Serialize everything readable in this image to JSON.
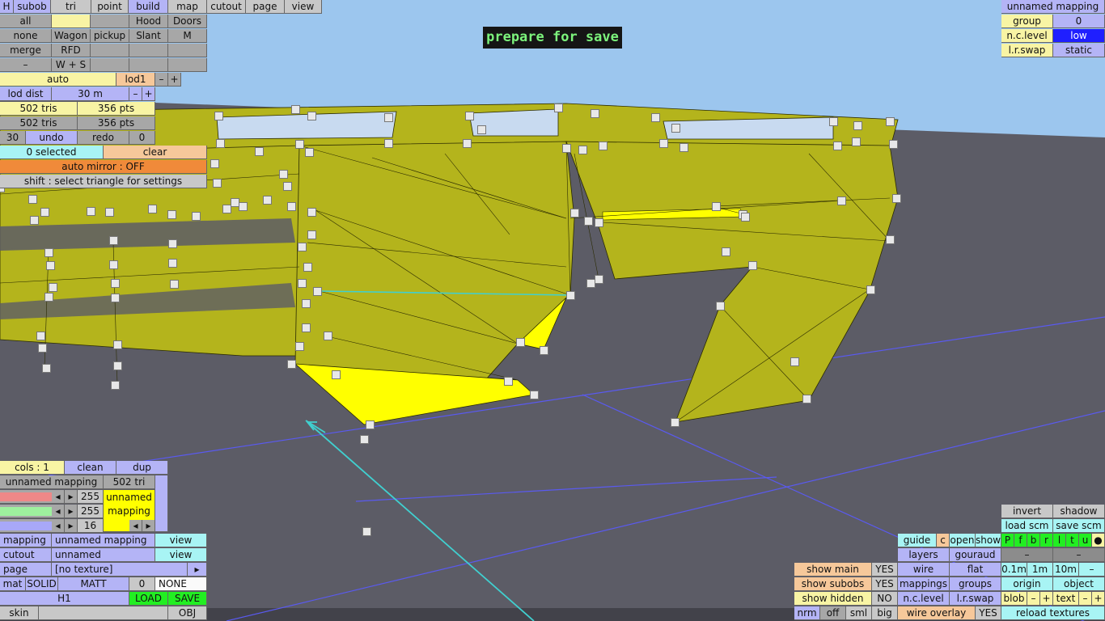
{
  "banner": "prepare for save",
  "colors": {
    "sky": "#9cc6ee",
    "ground": "#5c5c66",
    "mesh": "#b4b41c",
    "mesh_selected": "#ffff00",
    "grid_line": "#5a5af0",
    "accent_cyan": "#40d0d0"
  },
  "modes": [
    "H",
    "subob",
    "tri",
    "point",
    "build",
    "map",
    "cutout",
    "page",
    "view"
  ],
  "build_grid": {
    "row1": [
      "all",
      "",
      "",
      "Hood",
      "Doors"
    ],
    "row2": [
      "none",
      "Wagon",
      "pickup",
      "Slant",
      "M"
    ],
    "row3": [
      "merge",
      "RFD",
      "",
      "",
      ""
    ],
    "row4": [
      "–",
      "W + S",
      "",
      "",
      ""
    ]
  },
  "lod": {
    "auto": "auto",
    "lod": "lod1",
    "minus": "–",
    "plus": "+",
    "dist_label": "lod dist",
    "dist_value": "30 m",
    "tris1": "502 tris",
    "pts1": "356 pts",
    "tris2": "502 tris",
    "pts2": "356 pts"
  },
  "history": {
    "count": "30",
    "undo": "undo",
    "redo": "redo",
    "redo_count": "0"
  },
  "selection": {
    "selected": "0 selected",
    "clear": "clear",
    "auto_mirror": "auto mirror : OFF",
    "hint": "shift : select triangle for settings"
  },
  "mapping_panel": {
    "cols": "cols : 1",
    "clean": "clean",
    "dup": "dup",
    "mapping_name": "unnamed mapping",
    "tri_count": "502 tri",
    "sliders": [
      {
        "color": "#ee8888",
        "value": "255"
      },
      {
        "color": "#9ef09e",
        "value": "255"
      },
      {
        "color": "#a8a8f8",
        "value": "16"
      }
    ],
    "arrow_left": "◂",
    "arrow_right": "▸",
    "preview_line1": "unnamed",
    "preview_line2": "mapping",
    "rows": [
      {
        "label": "mapping",
        "value": "unnamed mapping",
        "action": "view"
      },
      {
        "label": "cutout",
        "value": "unnamed",
        "action": "view"
      },
      {
        "label": "page",
        "value": "[no texture]",
        "action": "▸"
      }
    ],
    "mat_label": "mat",
    "mat_solid": "SOLID",
    "mat_matt": "MATT",
    "mat_num": "0",
    "mat_none": "NONE",
    "h1": "H1",
    "load": "LOAD",
    "save": "SAVE",
    "skin": "skin",
    "obj": "OBJ"
  },
  "top_right": {
    "mapping_title": "unnamed mapping",
    "group_label": "group",
    "group_value": "0",
    "nclevel_label": "n.c.level",
    "nclevel_value": "low",
    "lrswap_label": "l.r.swap",
    "lrswap_value": "static"
  },
  "bottom_right": {
    "invert": "invert",
    "shadow": "shadow",
    "load_scm": "load scm",
    "save_scm": "save scm",
    "guide": "guide",
    "c": "c",
    "open": "open",
    "show": "show",
    "faces": [
      "P",
      "f",
      "b",
      "r",
      "l",
      "t",
      "u"
    ],
    "dot": "●",
    "layers": "layers",
    "gouraud": "gouraud",
    "dash": "–",
    "wire": "wire",
    "flat": "flat",
    "m01": "0.1m",
    "m1": "1m",
    "m10": "10m",
    "mappings": "mappings",
    "groups": "groups",
    "origin": "origin",
    "object": "object",
    "nclevel": "n.c.level",
    "lrswap": "l.r.swap",
    "blob": "blob",
    "text": "text",
    "minus": "–",
    "plus": "+",
    "show_main": "show main",
    "show_main_val": "YES",
    "show_subobs": "show subobs",
    "show_subobs_val": "YES",
    "show_hidden": "show hidden",
    "show_hidden_val": "NO",
    "nrm": "nrm",
    "off": "off",
    "sml": "sml",
    "big": "big",
    "wire_overlay": "wire overlay",
    "wire_overlay_val": "YES",
    "reload_textures": "reload textures"
  }
}
